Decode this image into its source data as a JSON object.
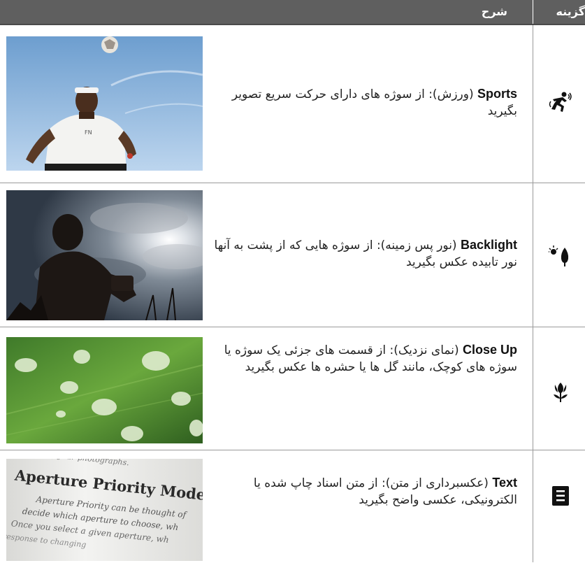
{
  "header": {
    "option_label": "گزینه",
    "description_label": "شرح"
  },
  "rows": [
    {
      "mode": "Sports",
      "description": " (ورزش): از سوژه های دارای حرکت سریع تصویر بگیرید",
      "icon": "sports-mode-icon"
    },
    {
      "mode": "Backlight",
      "description": " (نور پس زمینه): از سوژه هایی که از پشت به آنها نور تابیده عکس بگیرید",
      "icon": "backlight-mode-icon"
    },
    {
      "mode": "Close Up",
      "description": " (نمای نزدیک): از قسمت های جزئی یک سوژه یا سوژه های کوچک، مانند گل ها یا حشره ها عکس بگیرید",
      "icon": "close-up-mode-icon"
    },
    {
      "mode": "Text",
      "description": " (عکسبرداری از متن): از متن اسناد چاپ شده یا الکترونیکی، عکسی واضح بگیرید",
      "icon": "text-mode-icon"
    }
  ],
  "sample_text": {
    "line0": "of your photographs.",
    "heading": "Aperture Priority Mode",
    "line1": "Aperture Priority can be thought of",
    "line2": "decide which aperture to choose, wh",
    "line3": "Once you select a given aperture, wh",
    "line4": "response to changing"
  },
  "colors": {
    "header_bg": "#5f5f5f",
    "grid_line": "#9a9a9a"
  }
}
